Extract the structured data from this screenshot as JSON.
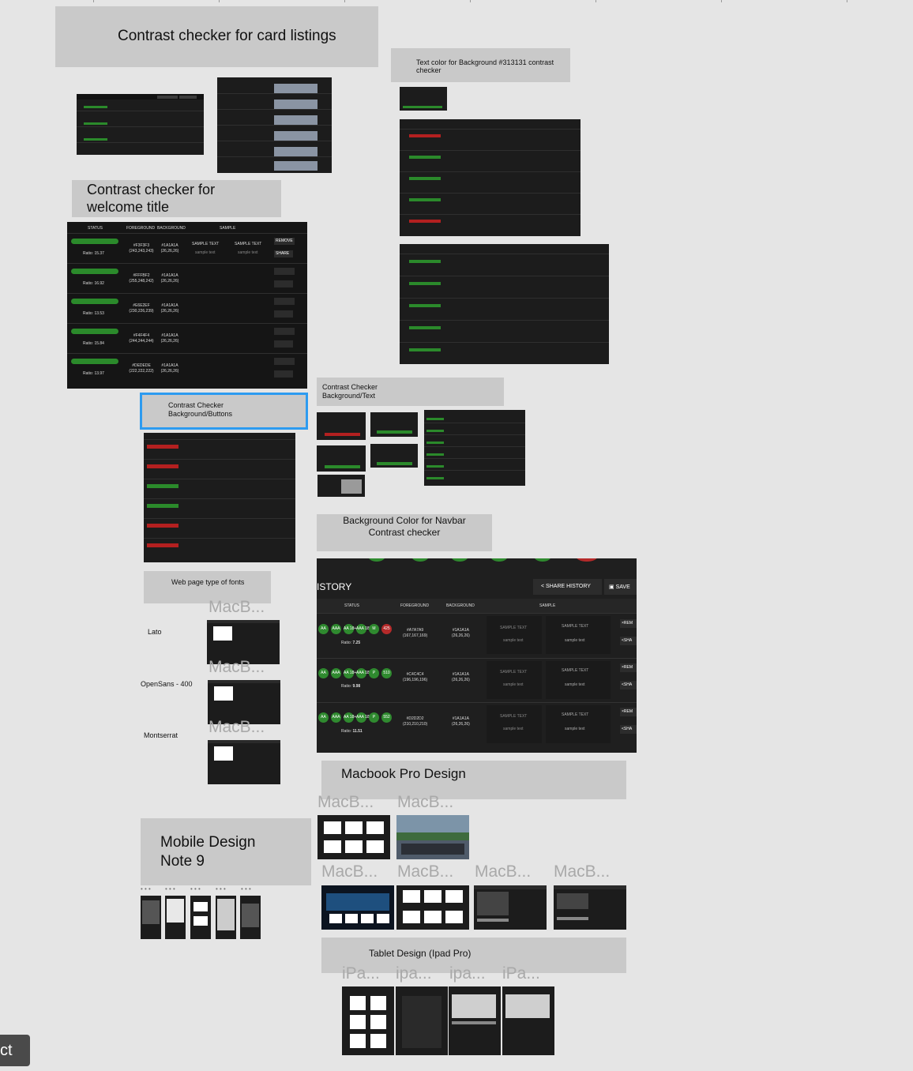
{
  "canvas": {
    "notes": {
      "card_listings": "Contrast checker for card listings",
      "text_color_bg": "Text color for Background #313131 contrast checker",
      "welcome_title": "Contrast checker for welcome title",
      "bg_buttons": "Contrast Checker Background/Buttons",
      "bg_text": "Contrast Checker Background/Text",
      "navbar": "Background Color for Navbar Contrast checker",
      "fonts": "Web page type of fonts",
      "macbook": "Macbook Pro Design",
      "mobile": "Mobile Design Note 9",
      "tablet": "Tablet Design (Ipad Pro)"
    },
    "fonts": [
      "Lato",
      "OpenSans - 400",
      "Montserrat"
    ],
    "frame_titles": {
      "macbook_short": "MacB...",
      "ipad_short_1": "iPa...",
      "ipad_short_2": "ipa...",
      "mobile_dots": "• • •"
    },
    "bottom_tool": "ct"
  },
  "history_panel": {
    "title": "ISTORY",
    "share_button": "SHARE HISTORY",
    "save_button": "SAVE",
    "columns": [
      "STATUS",
      "FOREGROUND",
      "BACKGROUND",
      "SAMPLE"
    ],
    "rows": [
      {
        "badges": [
          "AA",
          "AAA",
          "AA 18+",
          "AAA 18+",
          "M"
        ],
        "score": "425",
        "score_color": "red",
        "ratio_label": "Ratio:",
        "ratio": "7.25",
        "fg_hex": "#A7A7A9",
        "fg_rgb": "(167,167,169)",
        "bg_hex": "#1A1A1A",
        "bg_rgb": "(26,26,26)",
        "sample1_big": "SAMPLE TEXT",
        "sample1_small": "sample text",
        "sample2_big": "SAMPLE TEXT",
        "sample2_small": "sample text",
        "remove": "REM",
        "share": "SHA"
      },
      {
        "badges": [
          "AA",
          "AAA",
          "AA 18+",
          "AAA 18+",
          "P"
        ],
        "score": "510",
        "score_color": "green",
        "ratio_label": "Ratio:",
        "ratio": "9.98",
        "fg_hex": "#C4C4C4",
        "fg_rgb": "(196,196,196)",
        "bg_hex": "#1A1A1A",
        "bg_rgb": "(26,26,26)",
        "sample1_big": "SAMPLE TEXT",
        "sample1_small": "sample text",
        "sample2_big": "SAMPLE TEXT",
        "sample2_small": "sample text",
        "remove": "REM",
        "share": "SHA"
      },
      {
        "badges": [
          "AA",
          "AAA",
          "AA 18+",
          "AAA 18+",
          "P"
        ],
        "score": "552",
        "score_color": "green",
        "ratio_label": "Ratio:",
        "ratio": "11.51",
        "fg_hex": "#D2D2D2",
        "fg_rgb": "(210,210,210)",
        "bg_hex": "#1A1A1A",
        "bg_rgb": "(26,26,26)",
        "sample1_big": "SAMPLE TEXT",
        "sample1_small": "sample text",
        "sample2_big": "SAMPLE TEXT",
        "sample2_small": "sample text",
        "remove": "REM",
        "share": "SHA"
      }
    ]
  },
  "welcome_panel": {
    "columns": [
      "STATUS",
      "FOREGROUND",
      "BACKGROUND",
      "SAMPLE"
    ],
    "rows": [
      {
        "ratio": "Ratio: 15.37",
        "fg": "#F3F3F3 (243,243,243)",
        "bg": "#1A1A1A (26,26,26)"
      },
      {
        "ratio": "Ratio: 16.92",
        "fg": "#FFFBF2 (255,248,242)",
        "bg": "#1A1A1A (26,26,26)"
      },
      {
        "ratio": "Ratio: 13.53",
        "fg": "#E6E2EF (230,226,239)",
        "bg": "#1A1A1A (26,26,26)"
      },
      {
        "ratio": "Ratio: 15.84",
        "fg": "#F4F4F4 (244,244,244)",
        "bg": "#1A1A1A (26,26,26)"
      },
      {
        "ratio": "Ratio: 13.97",
        "fg": "#DEDEDE (222,222,222)",
        "bg": "#1A1A1A (26,26,26)"
      }
    ],
    "sample_big": "SAMPLE TEXT",
    "sample_small": "sample text",
    "remove": "REMOVE",
    "share": "SHARE"
  },
  "colors": {
    "canvas_bg": "#e5e5e5",
    "note_bg": "#c9c9c9",
    "frame_dark": "#1c1c1c",
    "selection": "#2d9bf0",
    "badge_green": "#2f8a2f",
    "badge_red": "#b52a2a"
  }
}
